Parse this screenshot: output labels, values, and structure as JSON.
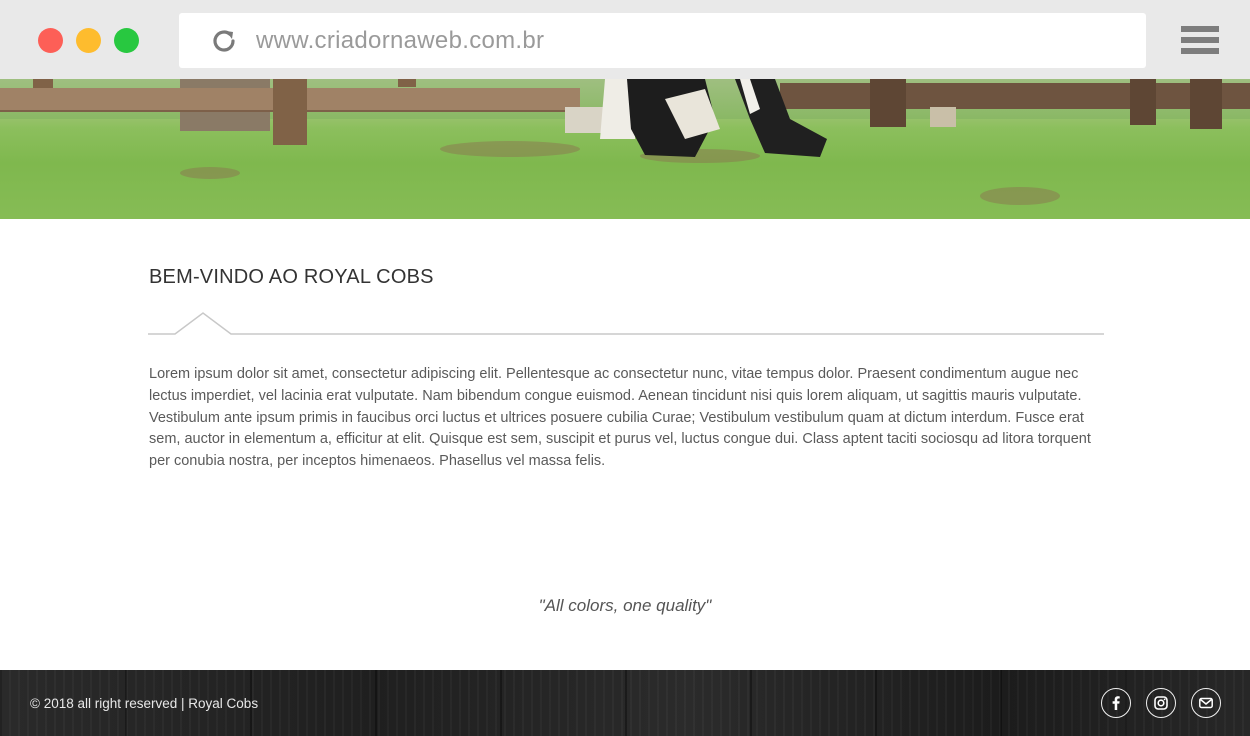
{
  "browser": {
    "url": "www.criadornaweb.com.br",
    "window_controls": [
      "close",
      "minimize",
      "maximize"
    ],
    "menu_icon": "hamburger-menu-icon",
    "reload_icon": "reload-icon"
  },
  "hero": {
    "image_description_icon": "hero-image"
  },
  "main": {
    "title": "BEM-VINDO AO ROYAL COBS",
    "body": "Lorem ipsum dolor sit amet, consectetur adipiscing elit. Pellentesque ac consectetur nunc, vitae tempus dolor. Praesent condimentum augue nec lectus imperdiet, vel lacinia erat vulputate. Nam bibendum congue euismod. Aenean tincidunt nisi quis lorem aliquam, ut sagittis mauris vulputate. Vestibulum ante ipsum primis in faucibus orci luctus et ultrices posuere cubilia Curae; Vestibulum vestibulum quam at dictum interdum. Fusce erat sem, auctor in elementum a, efficitur at elit. Quisque est sem, suscipit et purus vel, luctus congue dui. Class aptent taciti sociosqu ad litora torquent per conubia nostra, per inceptos himenaeos. Phasellus vel massa felis.",
    "quote": "\"All colors, one quality\""
  },
  "footer": {
    "copyright": "© 2018 all right reserved | Royal Cobs",
    "social": [
      {
        "name": "facebook-icon"
      },
      {
        "name": "instagram-icon"
      },
      {
        "name": "email-icon"
      }
    ]
  },
  "colors": {
    "close": "#fd5f57",
    "minimize": "#febc2e",
    "maximize": "#28c840",
    "chrome_bg": "#e9e9e9",
    "footer_bg": "#222222"
  }
}
